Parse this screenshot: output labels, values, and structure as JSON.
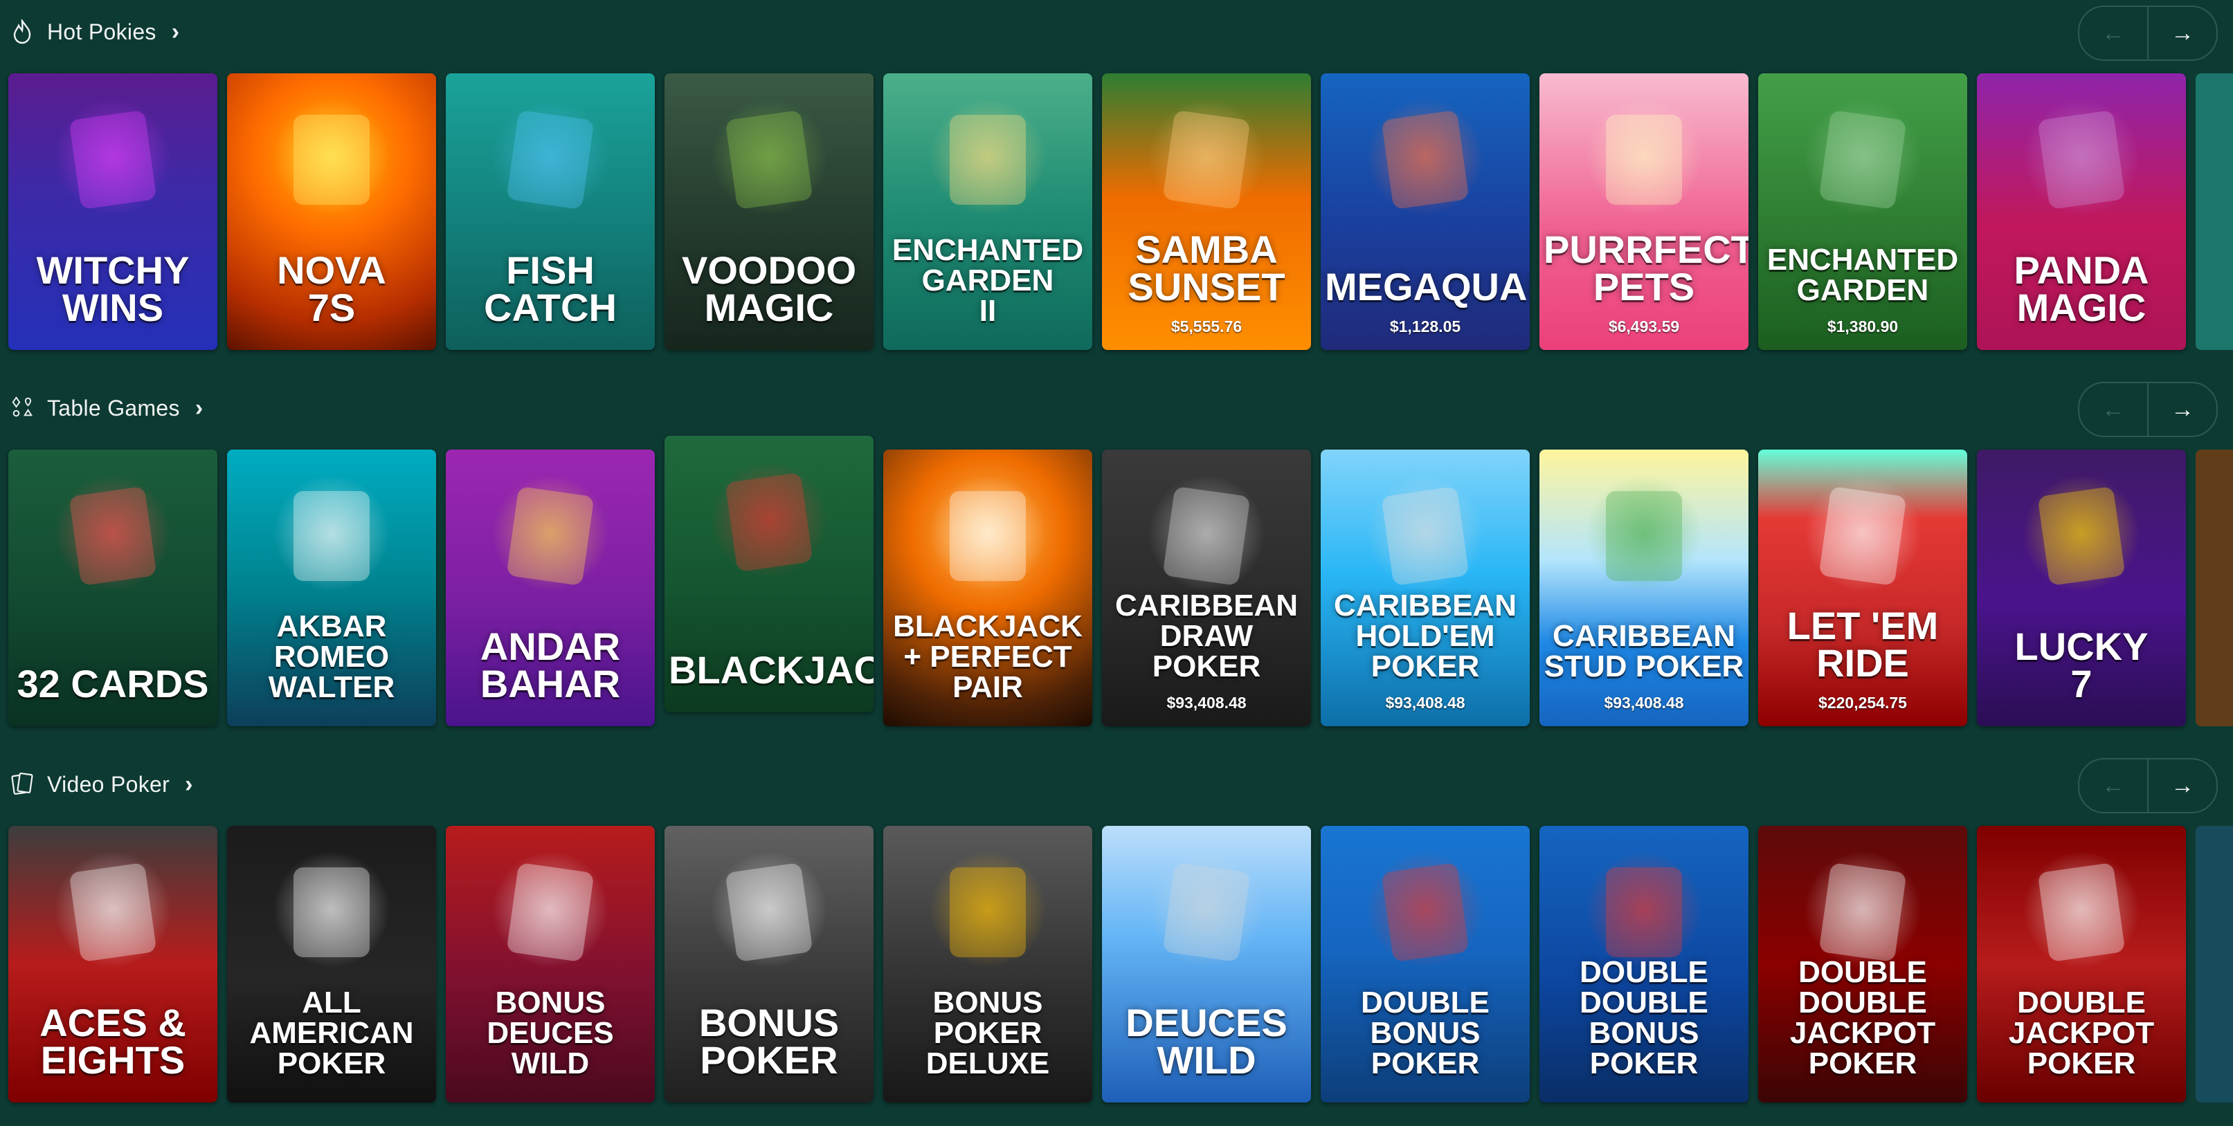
{
  "sections": [
    {
      "title": "Hot Pokies",
      "icon": "flame-icon",
      "tiles": [
        {
          "name": "Witchy\nWins",
          "jackpot": "",
          "bg": "linear-gradient(180deg,#5b1c8f 0%,#3b2aa8 45%,#2430b8 100%)",
          "deco": "#e040fb"
        },
        {
          "name": "Nova\n7s",
          "jackpot": "",
          "bg": "radial-gradient(circle at 50% 30%,#ffb300 0%,#ff6d00 35%,#b62e00 75%,#5d1200 100%)",
          "deco": "#fff176"
        },
        {
          "name": "Fish\nCatch",
          "jackpot": "",
          "bg": "linear-gradient(180deg,#1aa39a 0%,#137f7a 55%,#0e5f5c 100%)",
          "deco": "#4fc3f7"
        },
        {
          "name": "Voodoo\nMagic",
          "jackpot": "",
          "bg": "linear-gradient(180deg,#3b5a45 0%,#243b2d 55%,#17261d 100%)",
          "deco": "#8bc34a"
        },
        {
          "name": "Enchanted\nGarden\nII",
          "jackpot": "",
          "bg": "linear-gradient(180deg,#4caf8a 0%,#1f8c73 50%,#0f6a5c 100%)",
          "deco": "#ffe082"
        },
        {
          "name": "Samba\nSunset",
          "jackpot": "$5,555.76",
          "bg": "linear-gradient(180deg,#2e7d32 0%,#ef6c00 45%,#ff8f00 100%)",
          "deco": "#ffcc80"
        },
        {
          "name": "Megaquarium",
          "jackpot": "$1,128.05",
          "bg": "linear-gradient(180deg,#1565c0 0%,#1a3f9e 55%,#202a7a 100%)",
          "deco": "#ff7043"
        },
        {
          "name": "Purrfect\nPets",
          "jackpot": "$6,493.59",
          "bg": "linear-gradient(180deg,#f8bbd0 0%,#f06292 55%,#ec407a 100%)",
          "deco": "#fff9c4"
        },
        {
          "name": "Enchanted\nGarden",
          "jackpot": "$1,380.90",
          "bg": "linear-gradient(180deg,#43a047 0%,#2e7d32 55%,#1b5e20 100%)",
          "deco": "#a5d6a7"
        },
        {
          "name": "Panda\nMagic",
          "jackpot": "",
          "bg": "linear-gradient(180deg,#8e24aa 0%,#c2185b 55%,#ad1457 100%)",
          "deco": "#ce93d8"
        }
      ],
      "peek": "#1f7d72"
    },
    {
      "title": "Table Games",
      "icon": "cards-suits-icon",
      "tiles": [
        {
          "name": "32 Cards",
          "jackpot": "",
          "bg": "linear-gradient(180deg,#1b5e3b 0%,#124a31 55%,#0a3222 100%)",
          "deco": "#ff5252"
        },
        {
          "name": "Akbar\nRomeo\nWalter",
          "jackpot": "",
          "bg": "linear-gradient(180deg,#00acc1 0%,#00838f 50%,#0d3f5a 100%)",
          "deco": "#ffffff"
        },
        {
          "name": "Andar\nBahar",
          "jackpot": "",
          "bg": "linear-gradient(180deg,#9c27b0 0%,#7b1fa2 55%,#4a148c 100%)",
          "deco": "#ffd54f"
        },
        {
          "name": "Blackjack",
          "jackpot": "",
          "lift": true,
          "bg": "linear-gradient(180deg,#1f6a3d 0%,#155530 55%,#0c3a20 100%)",
          "deco": "#e53935"
        },
        {
          "name": "Blackjack\n+ Perfect Pair",
          "jackpot": "",
          "bg": "radial-gradient(circle at 50% 30%,#ffb74d 0%,#ef6c00 35%,#4e2207 80%,#1e0d02 100%)",
          "deco": "#ffffff"
        },
        {
          "name": "Caribbean\nDraw Poker",
          "jackpot": "$93,408.48",
          "bg": "linear-gradient(180deg,#3a3a3a 0%,#2b2b2b 55%,#1a1a1a 100%)",
          "deco": "#e0e0e0"
        },
        {
          "name": "Caribbean\nHold'em\nPoker",
          "jackpot": "$93,408.48",
          "bg": "linear-gradient(180deg,#81d4fa 0%,#29b6f6 45%,#0d6ea8 100%)",
          "deco": "#e0e0e0"
        },
        {
          "name": "Caribbean\nStud Poker",
          "jackpot": "$93,408.48",
          "bg": "linear-gradient(180deg,#fff59d 0%,#b3e5fc 40%,#1e88e5 70%,#1565c0 100%)",
          "deco": "#4caf50"
        },
        {
          "name": "Let 'Em\nRide",
          "jackpot": "$220,254.75",
          "bg": "linear-gradient(180deg,#64ffda 0%,#e53935 25%,#c62828 65%,#8e0000 100%)",
          "deco": "#ffffff"
        },
        {
          "name": "Lucky\n7",
          "jackpot": "",
          "bg": "linear-gradient(180deg,#3f1a66 0%,#4a148c 55%,#2b0e55 100%)",
          "deco": "#ffd600"
        }
      ],
      "peek": "#6a3f16"
    },
    {
      "title": "Video Poker",
      "icon": "poker-cards-icon",
      "tiles": [
        {
          "name": "Aces &\nEights",
          "jackpot": "",
          "bg": "linear-gradient(180deg,#3d3d3d 0%,#b71c1c 50%,#7f0000 100%)",
          "deco": "#ffffff"
        },
        {
          "name": "All\nAmerican\nPoker",
          "jackpot": "",
          "bg": "linear-gradient(180deg,#1b1b1b 0%,#262626 55%,#111111 100%)",
          "deco": "#ffffff"
        },
        {
          "name": "Bonus\nDeuces\nWild",
          "jackpot": "",
          "bg": "linear-gradient(180deg,#b71c1c 0%,#7f1030 55%,#4a0a1e 100%)",
          "deco": "#ffffff"
        },
        {
          "name": "Bonus\nPoker",
          "jackpot": "",
          "bg": "linear-gradient(180deg,#616161 0%,#3a3a3a 55%,#202020 100%)",
          "deco": "#ffffff"
        },
        {
          "name": "Bonus\nPoker\nDeluxe",
          "jackpot": "",
          "bg": "linear-gradient(180deg,#5a5a5a 0%,#333333 55%,#181818 100%)",
          "deco": "#ffc107"
        },
        {
          "name": "Deuces\nWild",
          "jackpot": "",
          "bg": "linear-gradient(180deg,#bbdefb 0%,#64b5f6 40%,#1e5fb8 100%)",
          "deco": "#cfd8dc"
        },
        {
          "name": "Double\nBonus\nPoker",
          "jackpot": "",
          "bg": "linear-gradient(180deg,#1976d2 0%,#1565c0 45%,#0d3e7a 100%)",
          "deco": "#e53935"
        },
        {
          "name": "Double Double\nBonus\nPoker",
          "jackpot": "",
          "bg": "linear-gradient(180deg,#1565c0 0%,#0d47a1 55%,#0a2e66 100%)",
          "deco": "#e53935"
        },
        {
          "name": "Double Double\nJackpot\nPoker",
          "jackpot": "",
          "bg": "linear-gradient(180deg,#5d0a0a 0%,#8b0000 50%,#3b0505 100%)",
          "deco": "#ffffff"
        },
        {
          "name": "Double\nJackpot\nPoker",
          "jackpot": "",
          "bg": "linear-gradient(180deg,#7f0000 0%,#b71c1c 50%,#6a0000 100%)",
          "deco": "#ffffff"
        }
      ],
      "peek": "#184f62"
    }
  ],
  "nav": {
    "prev_icon": "arrow-left-icon",
    "next_icon": "arrow-right-icon",
    "prev": "←",
    "next": "→",
    "chevron": "›"
  }
}
